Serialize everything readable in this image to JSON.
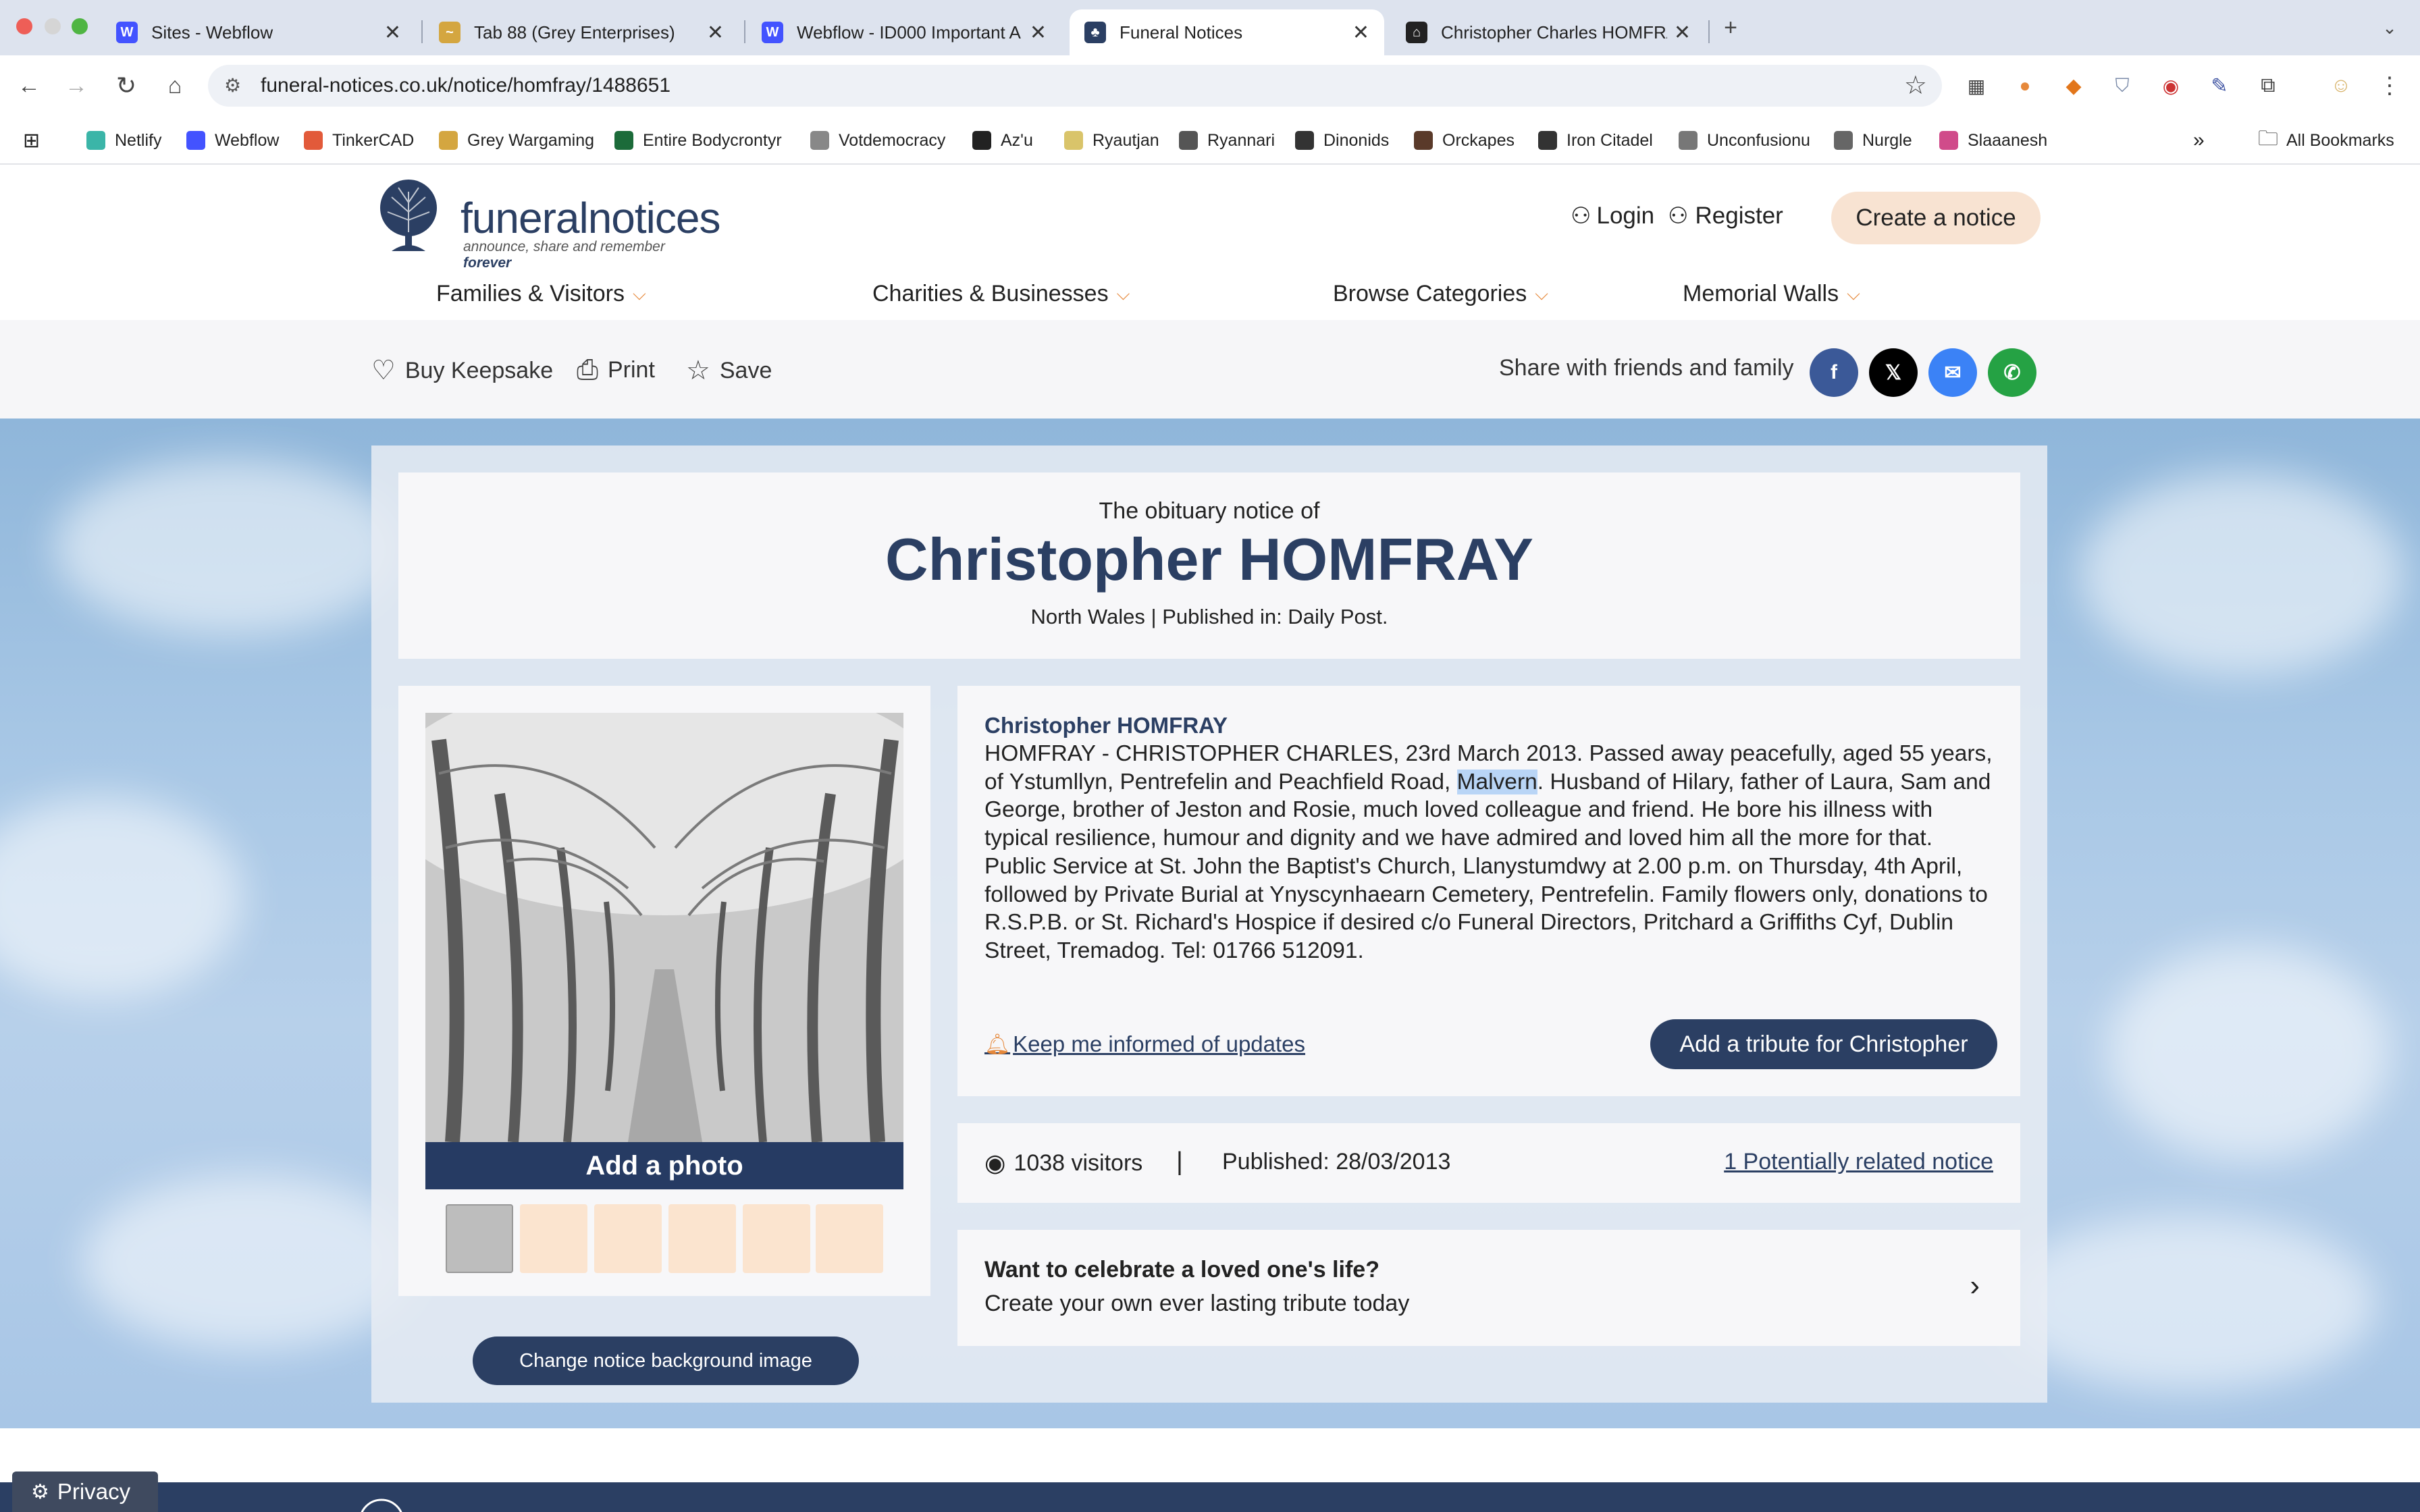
{
  "browser": {
    "tabs": [
      {
        "title": "Sites - Webflow",
        "icon": "webflow-icon",
        "color": "#4353ff"
      },
      {
        "title": "Tab 88 (Grey Enterprises)",
        "icon": "bird-icon",
        "color": "#d4a640"
      },
      {
        "title": "Webflow - ID000 Important A",
        "icon": "webflow-icon",
        "color": "#4353ff"
      },
      {
        "title": "Funeral Notices",
        "icon": "tree-icon",
        "color": "#2b3f63"
      },
      {
        "title": "Christopher Charles HOMFRA",
        "icon": "building-icon",
        "color": "#222222"
      }
    ],
    "active_tab": 3,
    "url": "funeral-notices.co.uk/notice/homfray/1488651",
    "bookmarks": [
      {
        "label": "Netlify",
        "color": "#3bb5a8"
      },
      {
        "label": "Webflow",
        "color": "#4353ff"
      },
      {
        "label": "TinkerCAD",
        "color": "#e25a3a"
      },
      {
        "label": "Grey Wargaming",
        "color": "#d4a640"
      },
      {
        "label": "Entire Bodycrontyr",
        "color": "#1c6b3a"
      },
      {
        "label": "Votdemocracy",
        "color": "#888888"
      },
      {
        "label": "Az'u",
        "color": "#222222"
      },
      {
        "label": "Ryautjan",
        "color": "#d9c46a"
      },
      {
        "label": "Ryannari",
        "color": "#555555"
      },
      {
        "label": "Dinonids",
        "color": "#333333"
      },
      {
        "label": "Orckapes",
        "color": "#5a3a2a"
      },
      {
        "label": "Iron Citadel",
        "color": "#333333"
      },
      {
        "label": "Unconfusionu",
        "color": "#777777"
      },
      {
        "label": "Nurgle",
        "color": "#666666"
      },
      {
        "label": "Slaaanesh",
        "color": "#d04b8a"
      }
    ],
    "all_bookmarks": "All Bookmarks"
  },
  "site": {
    "logo": {
      "name_a": "funeral",
      "name_b": "notices",
      "tagline": "announce, share and remember",
      "tagline_em": "forever"
    },
    "login": "Login",
    "register": "Register",
    "create": "Create a notice",
    "nav": [
      "Families & Visitors",
      "Charities & Businesses",
      "Browse Categories",
      "Memorial Walls"
    ]
  },
  "actions": {
    "keepsake": "Buy Keepsake",
    "print": "Print",
    "save": "Save",
    "share_label": "Share with friends and family"
  },
  "notice": {
    "subtitle": "The obituary notice of",
    "name": "Christopher HOMFRAY",
    "location": "North Wales | Published in: Daily Post.",
    "add_photo": "Add a photo",
    "change_bg": "Change notice background image",
    "detail_name": "Christopher HOMFRAY",
    "text_before": "HOMFRAY - CHRISTOPHER CHARLES, 23rd March 2013. Passed away peacefully, aged 55 years, of Ystumllyn, Pentrefelin and Peachfield Road, ",
    "text_highlight": "Malvern",
    "text_after": ". Husband of Hilary, father of Laura, Sam and George, brother of Jeston and Rosie, much loved colleague and friend. He bore his illness with typical resilience, humour and dignity and we have admired and loved him all the more for that. Public Service at St. John the Baptist's Church, Llanystumdwy at 2.00 p.m. on Thursday, 4th April, followed by Private Burial at Ynyscynhaearn Cemetery, Pentrefelin. Family flowers only, donations to R.S.P.B. or St. Richard's Hospice if desired c/o Funeral Directors, Pritchard a Griffiths Cyf, Dublin Street, Tremadog. Tel: 01766 512091.",
    "keep_informed": "Keep me informed of updates",
    "tribute": "Add a tribute for Christopher",
    "visitors": "1038 visitors",
    "published": "Published: 28/03/2013",
    "related": "1 Potentially related notice",
    "celebrate_q": "Want to celebrate a loved one's life?",
    "celebrate_s": "Create your own ever lasting tribute today"
  },
  "privacy": "Privacy"
}
